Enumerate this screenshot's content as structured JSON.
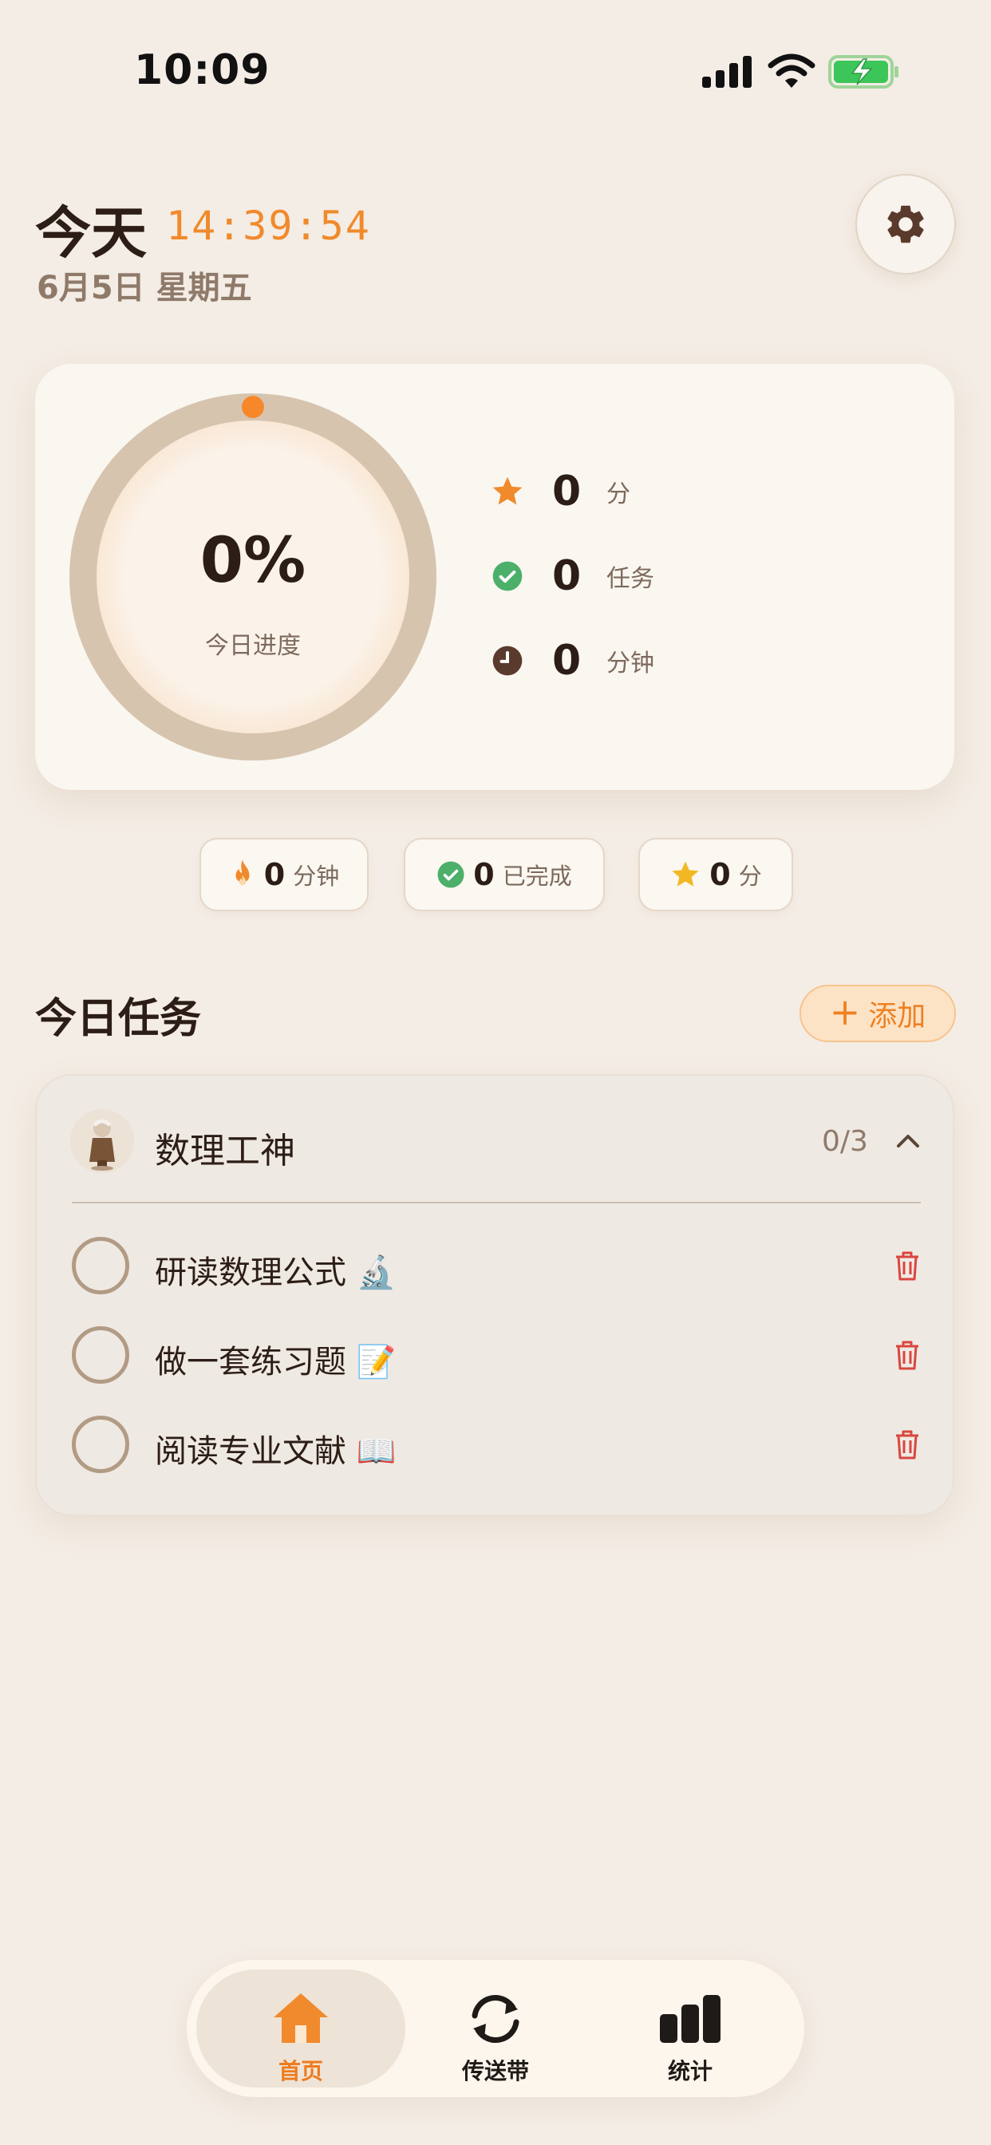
{
  "status_bar": {
    "time": "10:09"
  },
  "header": {
    "title": "今天",
    "clock": "14:39:54",
    "date": "6月5日 星期五",
    "settings_icon": "gear-icon"
  },
  "progress": {
    "percent_text": "0%",
    "percent_value": 0,
    "label": "今日进度",
    "stats": [
      {
        "icon": "star-icon",
        "value": "0",
        "unit": "分"
      },
      {
        "icon": "check-circle-icon",
        "value": "0",
        "unit": "任务"
      },
      {
        "icon": "clock-icon",
        "value": "0",
        "unit": "分钟"
      }
    ]
  },
  "chips": [
    {
      "icon": "flame-icon",
      "value": "0",
      "label": "分钟"
    },
    {
      "icon": "check-circle-icon",
      "value": "0",
      "label": "已完成"
    },
    {
      "icon": "star-icon",
      "value": "0",
      "label": "分"
    }
  ],
  "tasks_section": {
    "title": "今日任务",
    "add_label": "添加"
  },
  "task_group": {
    "name": "数理工神",
    "count": "0/3",
    "avatar_icon": "scholar-figurine-avatar",
    "items": [
      {
        "label": "研读数理公式 🔬",
        "done": false
      },
      {
        "label": "做一套练习题 📝",
        "done": false
      },
      {
        "label": "阅读专业文献 📖",
        "done": false
      }
    ]
  },
  "nav": [
    {
      "label": "首页",
      "icon": "home-icon",
      "active": true
    },
    {
      "label": "传送带",
      "icon": "sync-icon",
      "active": false
    },
    {
      "label": "统计",
      "icon": "bar-chart-icon",
      "active": false
    }
  ],
  "colors": {
    "background": "#f4ede5",
    "accent": "#f08a2c",
    "success": "#4caf6a",
    "danger": "#d9473f",
    "ring": "#d6c4ae"
  }
}
